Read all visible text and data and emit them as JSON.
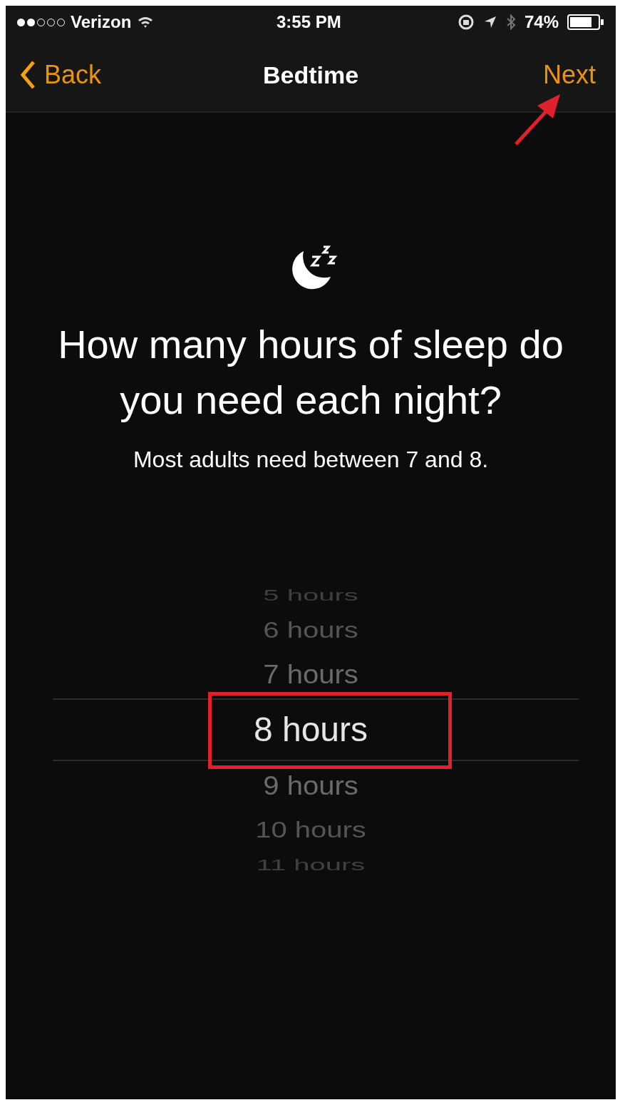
{
  "status_bar": {
    "carrier": "Verizon",
    "time": "3:55 PM",
    "battery": "74%"
  },
  "nav_bar": {
    "back": "Back",
    "title": "Bedtime",
    "next": "Next"
  },
  "heading": "How many hours of sleep do you need each night?",
  "subtitle": "Most adults need between 7 and 8.",
  "picker": {
    "items": [
      {
        "label": "5 hours",
        "selected": false
      },
      {
        "label": "6 hours",
        "selected": false
      },
      {
        "label": "7 hours",
        "selected": false
      },
      {
        "label": "8 hours",
        "selected": true
      },
      {
        "label": "9 hours",
        "selected": false
      },
      {
        "label": "10 hours",
        "selected": false
      },
      {
        "label": "11 hours",
        "selected": false
      }
    ]
  }
}
